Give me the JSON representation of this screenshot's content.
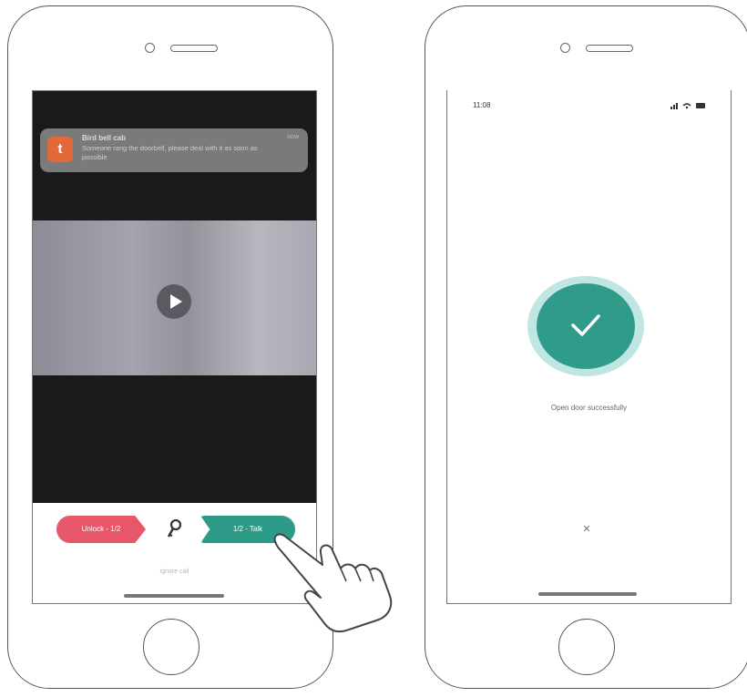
{
  "left_phone": {
    "notification": {
      "icon_glyph": "t",
      "app_name": "Bird bell cab",
      "time": "now",
      "message": "Someone rang the doorbell, please deal with it as soon as possible"
    },
    "actions": {
      "reject_label": "Unlock - 1/2",
      "accept_label": "1/2 - Talk",
      "link_label": "ignore call"
    },
    "colors": {
      "reject": "#e8566a",
      "accept": "#2e9a88",
      "notification_icon": "#e2683a"
    }
  },
  "right_phone": {
    "status_time": "11:08",
    "status_icons": "signal wifi battery",
    "success_message": "Open door successfully",
    "close_glyph": "✕",
    "colors": {
      "success": "#2f9c8a",
      "success_ring": "#bfe6e2"
    }
  }
}
